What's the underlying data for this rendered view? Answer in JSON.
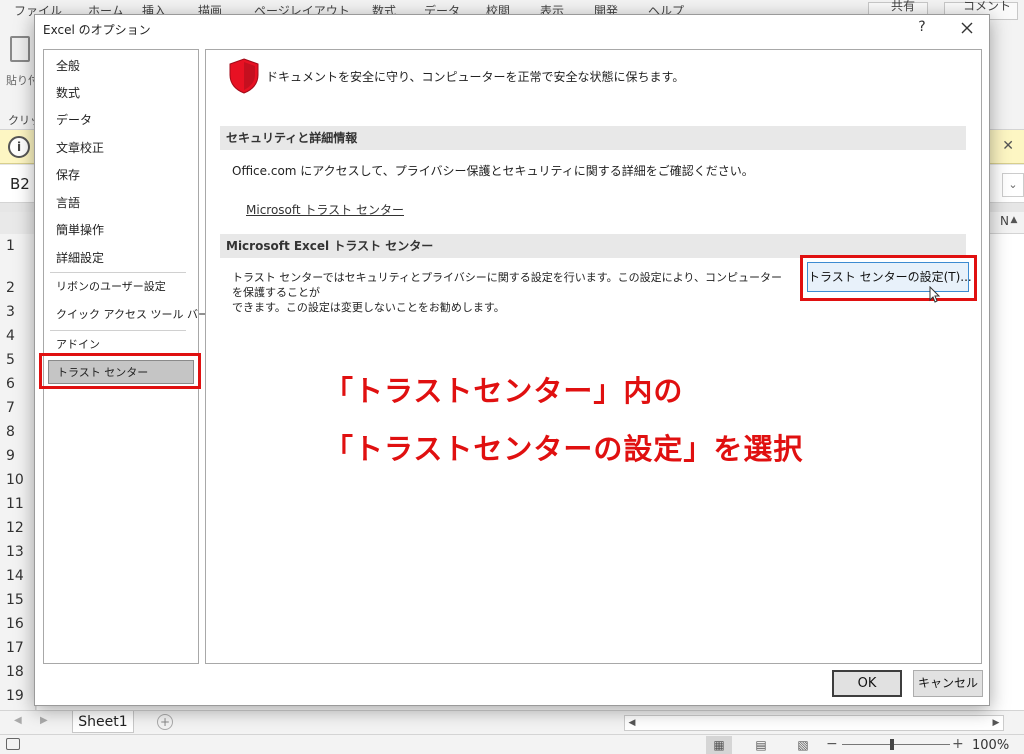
{
  "excel": {
    "ribbon_tabs": [
      "ファイル",
      "ホーム",
      "挿入",
      "描画",
      "ページレイアウト",
      "数式",
      "データ",
      "校閲",
      "表示",
      "開発",
      "ヘルプ"
    ],
    "share_label": "共有",
    "comment_label": "コメント",
    "paste_label": "貼り付け",
    "clipboard_label": "クリップボード",
    "name_box": "B2",
    "col_header_partial": "N",
    "row_numbers": [
      "1",
      "2",
      "3",
      "4",
      "5",
      "6",
      "7",
      "8",
      "9",
      "10",
      "11",
      "12",
      "13",
      "14",
      "15",
      "16",
      "17",
      "18",
      "19"
    ],
    "sheet_tab": "Sheet1",
    "zoom_level": "100%"
  },
  "dialog": {
    "title": "Excel のオプション",
    "help_label": "?",
    "nav": {
      "items": [
        "全般",
        "数式",
        "データ",
        "文章校正",
        "保存",
        "言語",
        "簡単操作",
        "詳細設定",
        "リボンのユーザー設定",
        "クイック アクセス ツール バー",
        "アドイン",
        "トラスト センター"
      ],
      "selected": "トラスト センター"
    },
    "intro_text": "ドキュメントを安全に守り、コンピューターを正常で安全な状態に保ちます。",
    "security_section": {
      "header": "セキュリティと詳細情報",
      "description": "Office.com にアクセスして、プライバシー保護とセキュリティに関する詳細をご確認ください。",
      "link": "Microsoft トラスト センター"
    },
    "trust_section": {
      "header": "Microsoft Excel トラスト センター",
      "description_line1": "トラスト センターではセキュリティとプライバシーに関する設定を行います。この設定により、コンピューターを保護することが",
      "description_line2": "できます。この設定は変更しないことをお勧めします。",
      "button": "トラスト センターの設定(T)..."
    },
    "annotation": {
      "line1": "「トラストセンター」内の",
      "line2": "「トラストセンターの設定」を選択"
    },
    "ok_label": "OK",
    "cancel_label": "キャンセル"
  },
  "colors": {
    "highlight_red": "#e01010",
    "shield_red": "#e81123",
    "selected_nav": "#c5c5c5",
    "button_focus_blue": "#3d8bd1"
  }
}
